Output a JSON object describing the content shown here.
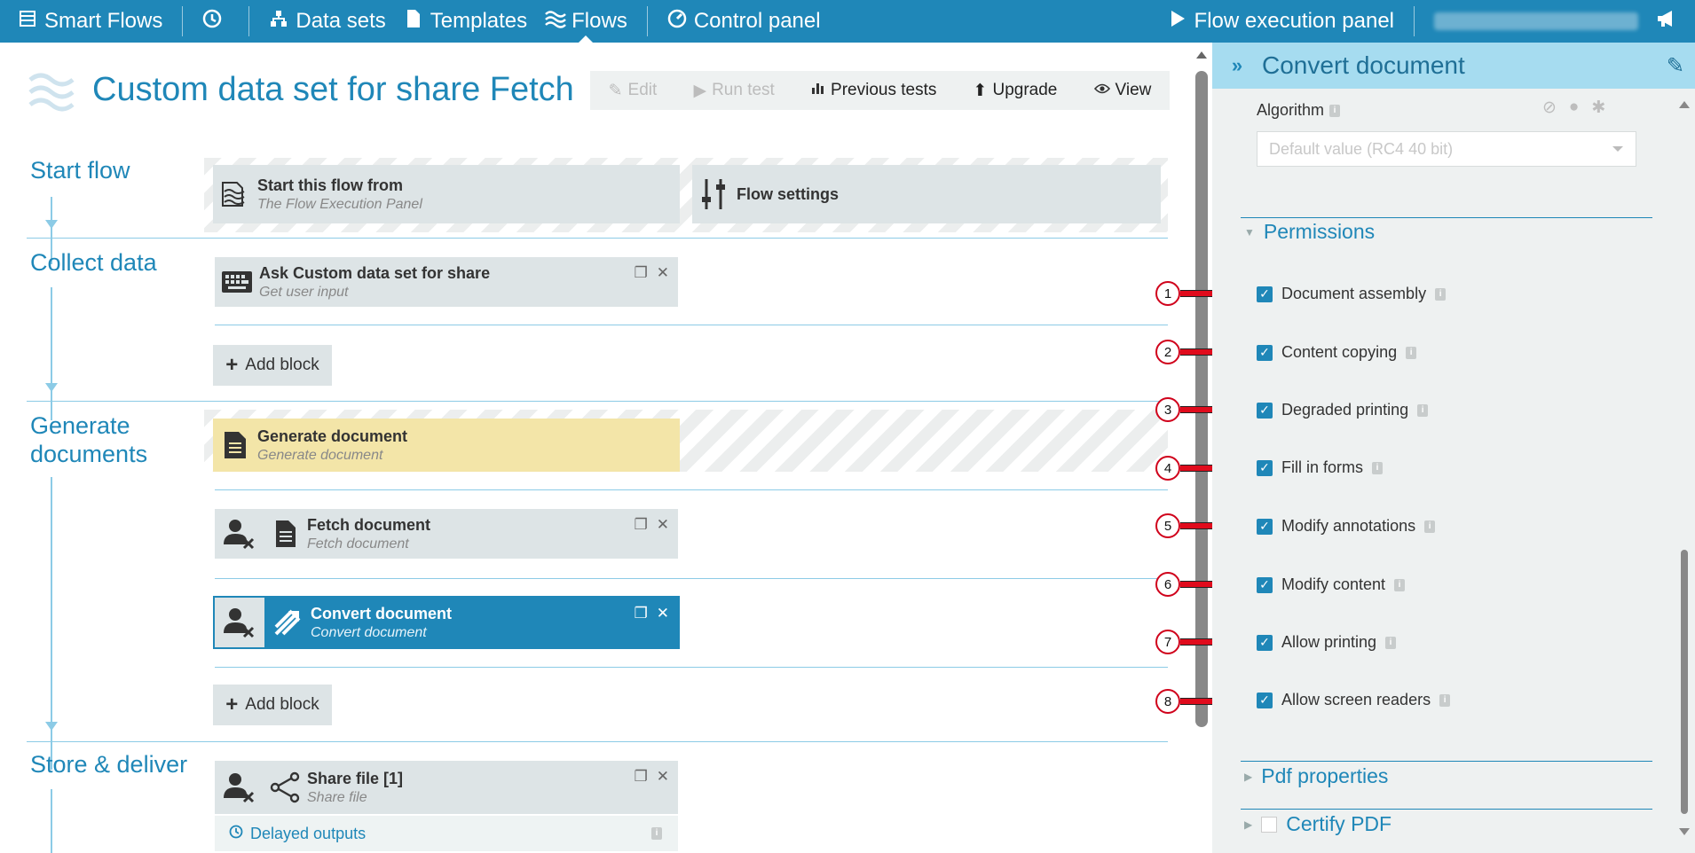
{
  "topnav": {
    "brand": "Smart Flows",
    "data_sets": "Data sets",
    "templates": "Templates",
    "flows": "Flows",
    "control_panel": "Control panel",
    "flow_execution_panel": "Flow execution panel",
    "icons": {
      "brand": "layers-icon",
      "history": "clock-icon",
      "data_sets": "sitemap-icon",
      "templates": "file-icon",
      "flows": "waves-icon",
      "control_panel": "gauge-icon",
      "execution": "play-icon",
      "notifications": "megaphone-icon"
    }
  },
  "page": {
    "title": "Custom data set for share Fetch"
  },
  "toolbar": {
    "edit": "Edit",
    "run_test": "Run test",
    "previous_tests": "Previous tests",
    "upgrade": "Upgrade",
    "view": "View"
  },
  "sections": {
    "start_flow": "Start flow",
    "collect_data": "Collect data",
    "generate_documents_1": "Generate",
    "generate_documents_2": "documents",
    "store_deliver": "Store & deliver"
  },
  "blocks": {
    "start_from": {
      "name": "Start this flow from",
      "sub": "The Flow Execution Panel"
    },
    "flow_settings": {
      "name": "Flow settings"
    },
    "ask_custom": {
      "name": "Ask Custom data set for share",
      "sub": "Get user input"
    },
    "generate_doc": {
      "name": "Generate document",
      "sub": "Generate document"
    },
    "fetch_doc": {
      "name": "Fetch document",
      "sub": "Fetch document"
    },
    "convert_doc": {
      "name": "Convert document",
      "sub": "Convert document"
    },
    "share_file": {
      "name": "Share file [1]",
      "sub": "Share file"
    }
  },
  "add_block": "Add block",
  "delayed_outputs": "Delayed outputs",
  "panel": {
    "title": "Convert document",
    "algorithm_label": "Algorithm",
    "algorithm_value": "Default value (RC4 40 bit)",
    "permissions_title": "Permissions",
    "permissions": [
      {
        "label": "Document assembly",
        "checked": true
      },
      {
        "label": "Content copying",
        "checked": true
      },
      {
        "label": "Degraded printing",
        "checked": true
      },
      {
        "label": "Fill in forms",
        "checked": true
      },
      {
        "label": "Modify annotations",
        "checked": true
      },
      {
        "label": "Modify content",
        "checked": true
      },
      {
        "label": "Allow printing",
        "checked": true
      },
      {
        "label": "Allow screen readers",
        "checked": true
      }
    ],
    "pdf_properties": "Pdf properties",
    "certify_pdf": "Certify PDF"
  },
  "annotations": [
    "1",
    "2",
    "3",
    "4",
    "5",
    "6",
    "7",
    "8"
  ],
  "colors": {
    "accent": "#1f87b8",
    "panel_header": "#a6dcf0",
    "arrow": "#e00b1c",
    "yellow_block": "#f3e5a8"
  }
}
